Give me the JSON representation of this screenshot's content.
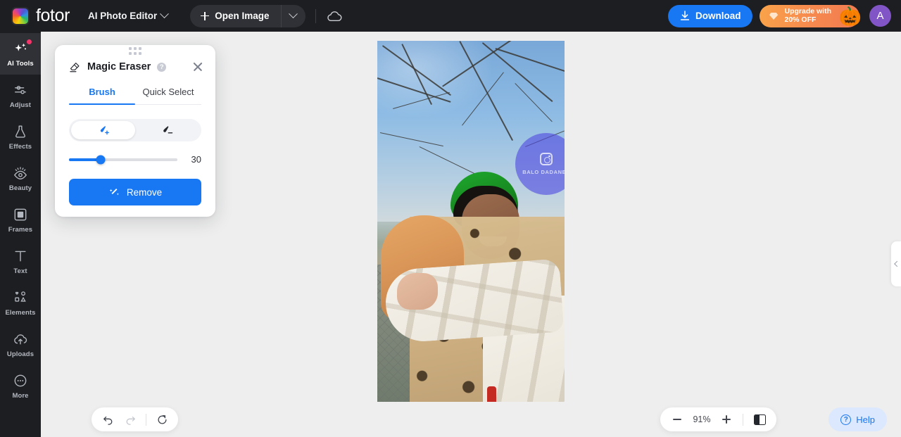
{
  "app": {
    "brand": "fotor",
    "brand_logo_icon": "fotor-rainbow-logo",
    "editor_name": "AI Photo Editor"
  },
  "topbar": {
    "open_image_label": "Open Image",
    "open_image_plus_icon": "plus-icon",
    "open_image_caret_icon": "chevron-down-icon",
    "cloud_icon": "cloud-icon",
    "download_label": "Download",
    "download_icon": "download-icon",
    "download_color": "#1877f2",
    "upgrade_line1": "Upgrade with",
    "upgrade_line2": "20% OFF",
    "upgrade_diamond_icon": "diamond-icon",
    "upgrade_pumpkin_icon": "🎃",
    "upgrade_color": "#f7904d",
    "avatar_initial": "A",
    "avatar_color": "#8155c6"
  },
  "sidebar": {
    "items": [
      {
        "label": "AI Tools",
        "icon": "sparkles-icon",
        "active": true,
        "badge": true
      },
      {
        "label": "Adjust",
        "icon": "sliders-icon",
        "active": false,
        "badge": false
      },
      {
        "label": "Effects",
        "icon": "flask-icon",
        "active": false,
        "badge": false
      },
      {
        "label": "Beauty",
        "icon": "eye-icon",
        "active": false,
        "badge": false
      },
      {
        "label": "Frames",
        "icon": "frame-icon",
        "active": false,
        "badge": false
      },
      {
        "label": "Text",
        "icon": "text-t-icon",
        "active": false,
        "badge": false
      },
      {
        "label": "Elements",
        "icon": "shapes-icon",
        "active": false,
        "badge": false
      },
      {
        "label": "Uploads",
        "icon": "upload-cloud-icon",
        "active": false,
        "badge": false
      },
      {
        "label": "More",
        "icon": "ellipsis-circle-icon",
        "active": false,
        "badge": false
      }
    ],
    "badge_color": "#f8356b"
  },
  "panel": {
    "drag_handle_icon": "drag-dots-icon",
    "title": "Magic Eraser",
    "title_icon": "magic-eraser-icon",
    "help_icon": "question-mark-icon",
    "close_icon": "close-icon",
    "accent_color": "#1877f2",
    "tabs": [
      {
        "label": "Brush",
        "active": true
      },
      {
        "label": "Quick Select",
        "active": false
      }
    ],
    "brush_modes": [
      {
        "icon": "brush-add-icon",
        "active": true
      },
      {
        "icon": "brush-erase-icon",
        "active": false
      }
    ],
    "brush_size": "30",
    "brush_size_percent": 29,
    "remove_label": "Remove",
    "remove_icon": "magic-wand-icon"
  },
  "canvas": {
    "image_description": "Two people hugging outdoors under bare winter tree branches; one wears a green beanie, the other a leopard-print coat",
    "selection_overlay": {
      "watermark_icon": "instagram-icon",
      "watermark_text": "BALO DADANES",
      "color": "#504ae0"
    },
    "collapse_handle_icon": "chevron-left-icon"
  },
  "bottombar": {
    "undo_icon": "undo-arrow-icon",
    "redo_icon": "redo-arrow-icon",
    "reset_icon": "reset-circular-arrow-icon",
    "zoom_out_icon": "minus-icon",
    "zoom_level": "91%",
    "zoom_in_icon": "plus-icon",
    "compare_icon": "compare-split-icon",
    "help_label": "Help",
    "help_icon": "question-circle-icon",
    "help_color": "#1877f2"
  }
}
